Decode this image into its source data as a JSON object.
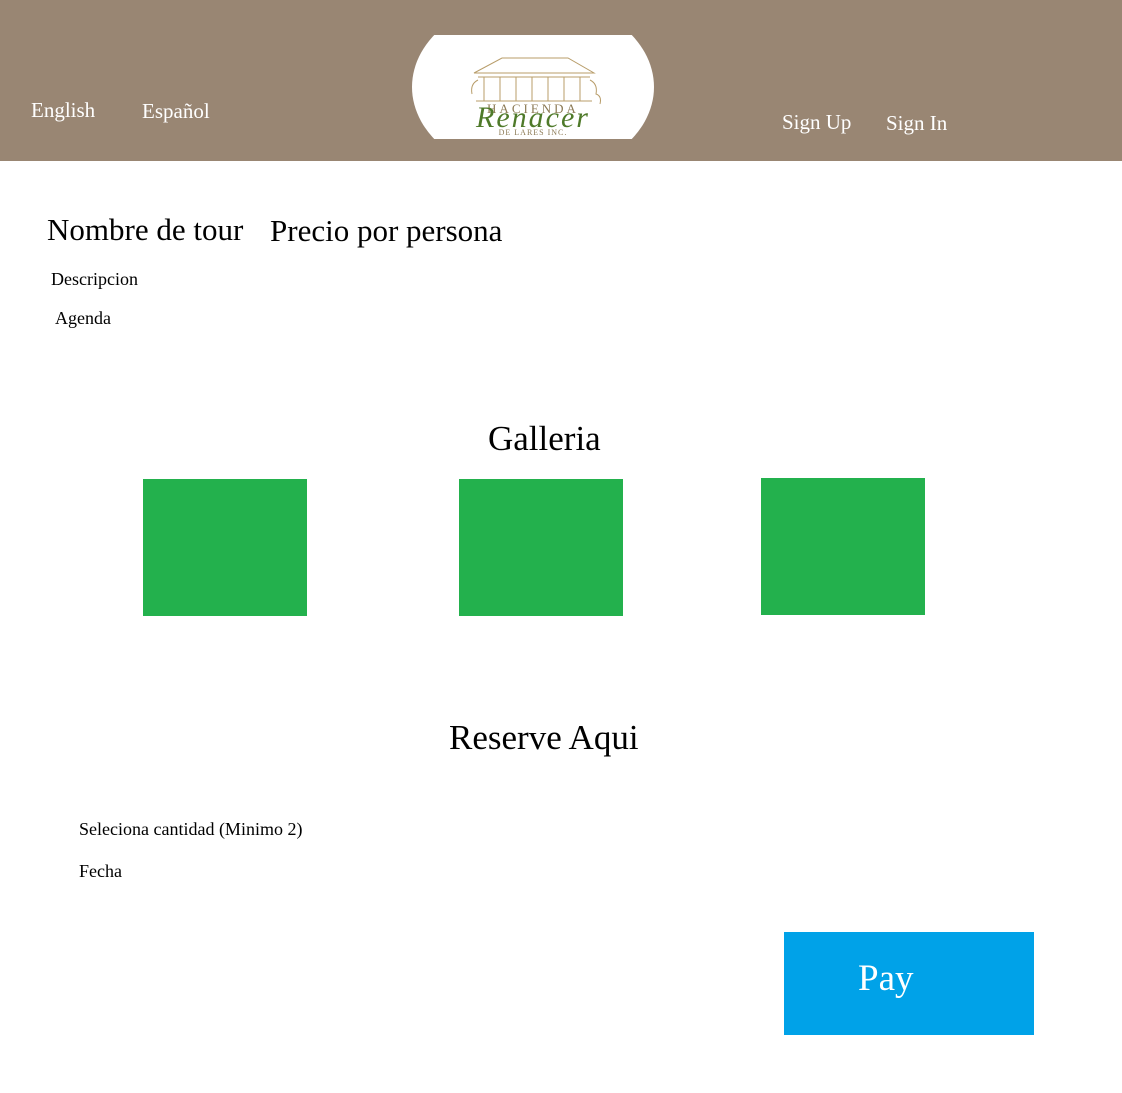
{
  "colors": {
    "header_bg": "#998673",
    "tile_green": "#23b14d",
    "pay_blue": "#00a2e8",
    "logo_green": "#4f7a2a",
    "logo_tan": "#b89d6a"
  },
  "header": {
    "lang_english": "English",
    "lang_spanish": "Español",
    "sign_up": "Sign Up",
    "sign_in": "Sign In",
    "logo": {
      "top": "HACIENDA",
      "script": "Renacer",
      "bottom": "DE LARES INC."
    }
  },
  "tour": {
    "name": "Nombre de tour",
    "price": "Precio por persona",
    "description": "Descripcion",
    "agenda": "Agenda"
  },
  "gallery": {
    "title": "Galleria"
  },
  "reserve": {
    "title": "Reserve Aqui",
    "quantity_label": "Seleciona cantidad (Minimo 2)",
    "date_label": "Fecha",
    "pay_label": "Pay"
  }
}
